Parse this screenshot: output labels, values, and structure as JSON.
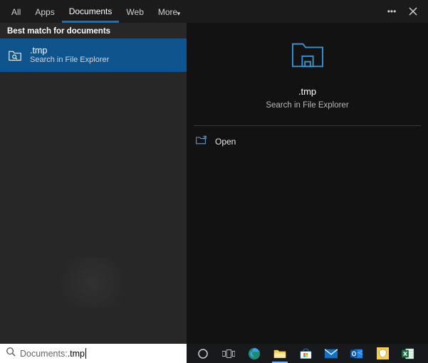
{
  "tabs": {
    "all": "All",
    "apps": "Apps",
    "documents": "Documents",
    "web": "Web",
    "more": "More"
  },
  "group_header": "Best match for documents",
  "result": {
    "title": ".tmp",
    "subtitle": "Search in File Explorer"
  },
  "preview": {
    "title": ".tmp",
    "subtitle": "Search in File Explorer"
  },
  "actions": {
    "open": "Open"
  },
  "search": {
    "scope": "Documents: ",
    "query": ".tmp"
  },
  "icons": {
    "folder": "folder-search-icon",
    "open": "open-in-explorer-icon",
    "ellipsis": "more-dots-icon",
    "close": "close-icon",
    "magnify": "search-icon"
  },
  "taskbar_apps": [
    "cortana",
    "task-view",
    "edge",
    "file-explorer",
    "store",
    "mail",
    "outlook",
    "security",
    "excel"
  ],
  "colors": {
    "accent": "#0078d4",
    "selection": "#0f548c",
    "icon_blue": "#3892d3"
  }
}
